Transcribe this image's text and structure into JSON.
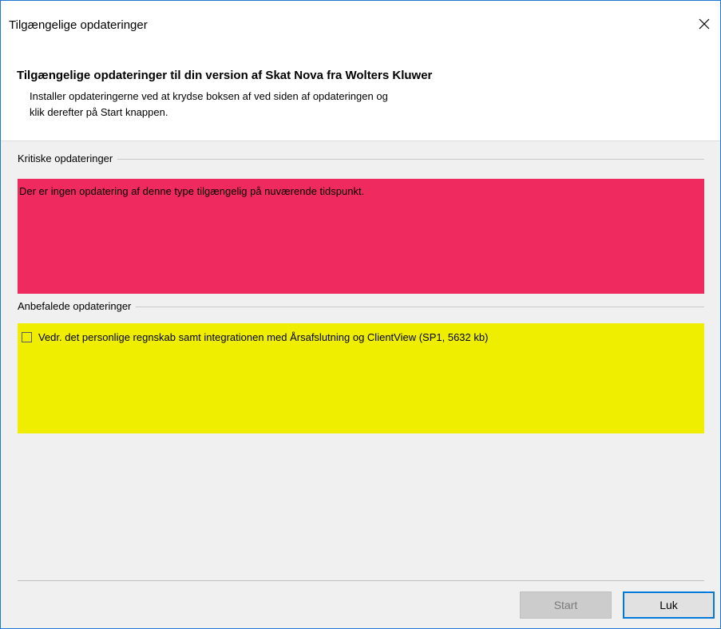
{
  "window": {
    "title": "Tilgængelige opdateringer"
  },
  "header": {
    "title": "Tilgængelige opdateringer til din version af Skat Nova fra Wolters Kluwer",
    "description_line1": "Installer opdateringerne ved at krydse boksen af ved siden af opdateringen og",
    "description_line2": "klik derefter på Start knappen."
  },
  "critical": {
    "label": "Kritiske opdateringer",
    "message": "Der er ingen opdatering af denne type tilgængelig på nuværende tidspunkt.",
    "color": "#ee2a5e"
  },
  "recommended": {
    "label": "Anbefalede opdateringer",
    "color": "#f0ee00",
    "items": [
      {
        "label": "Vedr. det personlige regnskab samt integrationen med Årsafslutning og ClientView (SP1, 5632 kb)",
        "checked": false
      }
    ]
  },
  "buttons": {
    "start_label": "Start",
    "close_label": "Luk"
  },
  "icons": {
    "close": "close-icon"
  }
}
